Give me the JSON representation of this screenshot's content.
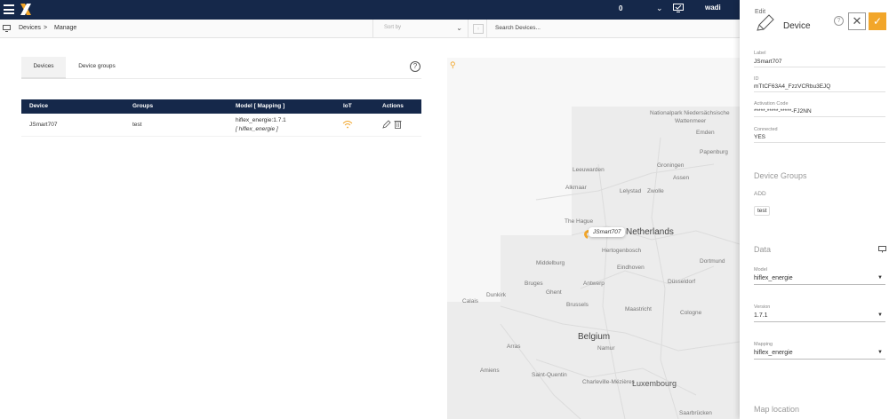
{
  "topbar": {
    "count": "0",
    "user": "wadi"
  },
  "breadcrumb": {
    "root": "Devices",
    "separator": ">",
    "current": "Manage"
  },
  "toolbar": {
    "sort_placeholder": "Sort by",
    "search_value": "Search Devices..."
  },
  "tabs": [
    {
      "label": "Devices"
    },
    {
      "label": "Device groups"
    }
  ],
  "table": {
    "headers": [
      "Device",
      "Groups",
      "Model [ Mapping ]",
      "IoT",
      "Actions"
    ],
    "rows": [
      {
        "device": "JSmart707",
        "groups": "test",
        "model": "hiflex_energie:1.7.1",
        "mapping": "[ hiflex_energie ]"
      }
    ]
  },
  "map": {
    "marker_label": "JSmart707",
    "labels": [
      {
        "text": "Nationalpark Niedersächsische",
        "cls": ""
      },
      {
        "text": "Wattenmeer",
        "cls": ""
      },
      {
        "text": "Emden",
        "cls": ""
      },
      {
        "text": "Papenburg",
        "cls": ""
      },
      {
        "text": "Leeuwarden",
        "cls": ""
      },
      {
        "text": "Groningen",
        "cls": ""
      },
      {
        "text": "Assen",
        "cls": ""
      },
      {
        "text": "Alkmaar",
        "cls": ""
      },
      {
        "text": "Lelystad",
        "cls": ""
      },
      {
        "text": "Zwolle",
        "cls": ""
      },
      {
        "text": "The Hague",
        "cls": ""
      },
      {
        "text": "Netherlands",
        "cls": "xbig"
      },
      {
        "text": "Hertogenbosch",
        "cls": ""
      },
      {
        "text": "Eindhoven",
        "cls": ""
      },
      {
        "text": "Dortmund",
        "cls": ""
      },
      {
        "text": "Middelburg",
        "cls": ""
      },
      {
        "text": "Antwerp",
        "cls": ""
      },
      {
        "text": "Bruges",
        "cls": ""
      },
      {
        "text": "Ghent",
        "cls": ""
      },
      {
        "text": "Düsseldorf",
        "cls": ""
      },
      {
        "text": "Dunkirk",
        "cls": ""
      },
      {
        "text": "Calais",
        "cls": ""
      },
      {
        "text": "Brussels",
        "cls": ""
      },
      {
        "text": "Maastricht",
        "cls": ""
      },
      {
        "text": "Cologne",
        "cls": ""
      },
      {
        "text": "Belgium",
        "cls": "xbig"
      },
      {
        "text": "Arras",
        "cls": ""
      },
      {
        "text": "Namur",
        "cls": ""
      },
      {
        "text": "Amiens",
        "cls": ""
      },
      {
        "text": "Saint-Quentin",
        "cls": ""
      },
      {
        "text": "Charleville-Mézières",
        "cls": ""
      },
      {
        "text": "Luxembourg",
        "cls": "big"
      },
      {
        "text": "Saarbrücken",
        "cls": ""
      }
    ]
  },
  "panel": {
    "edit_label": "Edit",
    "title": "Device",
    "fields": [
      {
        "label": "Label",
        "value": "JSmart707"
      },
      {
        "label": "ID",
        "value": "mTtCF63A4_FzzVCRbu3EJQ"
      },
      {
        "label": "Activation Code",
        "value": "*****-*****-*****-FJ2NN"
      },
      {
        "label": "Connected",
        "value": "YES"
      }
    ],
    "device_groups_title": "Device Groups",
    "add_label": "ADD",
    "group_chip": "test",
    "data_title": "Data",
    "selects": [
      {
        "label": "Model",
        "value": "hiflex_energie"
      },
      {
        "label": "Version",
        "value": "1.7.1"
      },
      {
        "label": "Mapping",
        "value": "hiflex_energie"
      }
    ],
    "map_location_title": "Map location"
  },
  "colors": {
    "navy": "#15284a",
    "accent": "#f2a62a"
  }
}
